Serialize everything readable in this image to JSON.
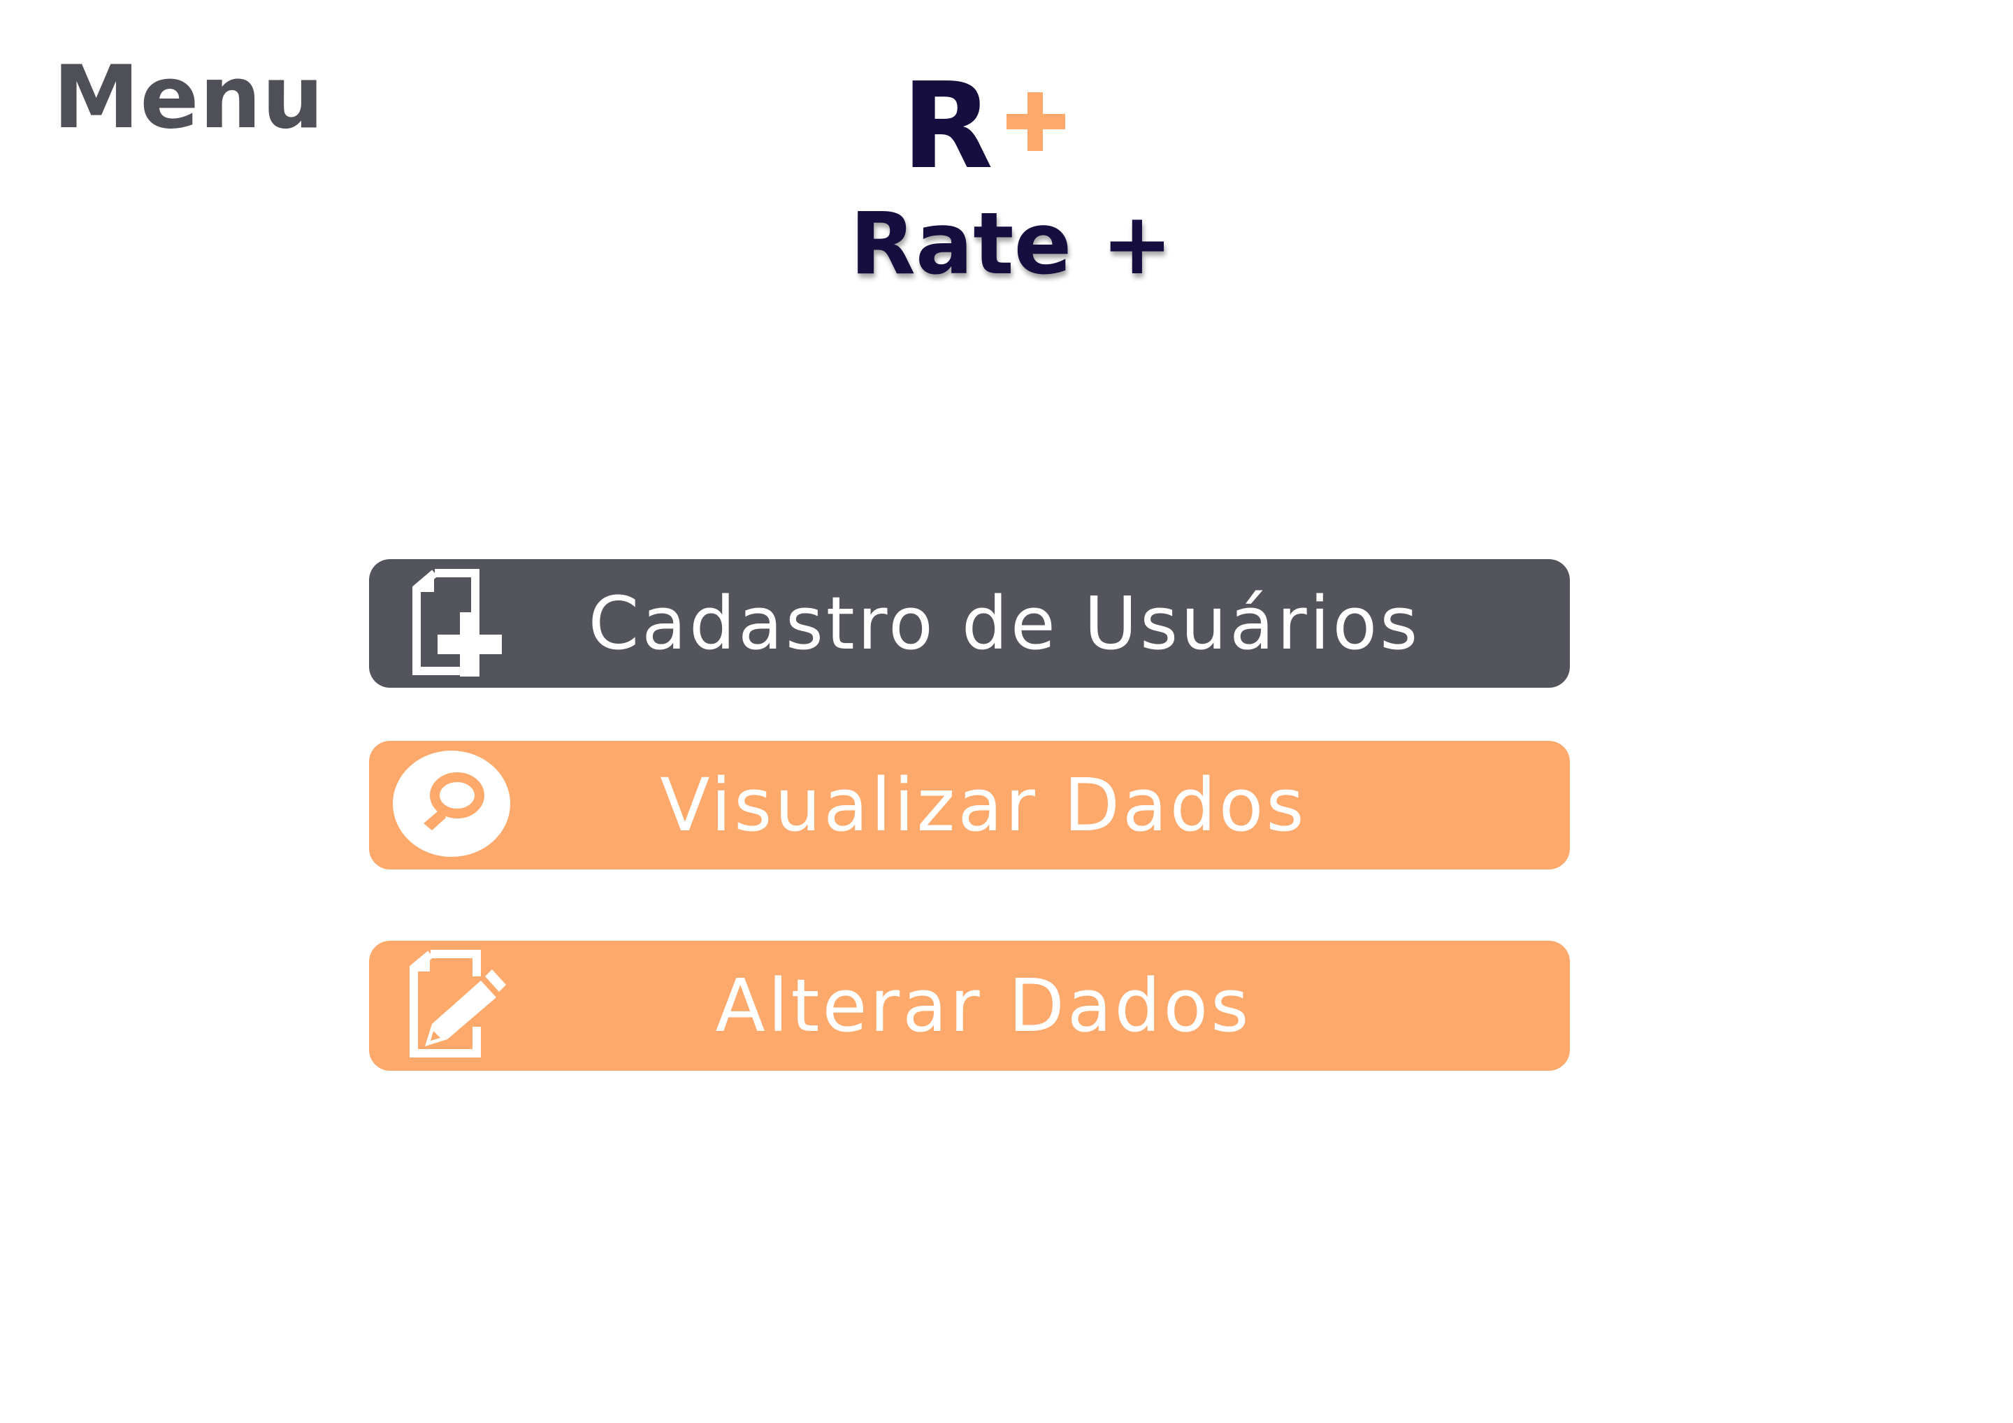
{
  "header": {
    "title": "Menu"
  },
  "logo": {
    "letter": "R",
    "app_name": "Rate +"
  },
  "menu": {
    "items": [
      {
        "label": "Cadastro de Usuários",
        "icon": "add-document-icon"
      },
      {
        "label": "Visualizar Dados",
        "icon": "search-icon"
      },
      {
        "label": "Alterar Dados",
        "icon": "edit-document-icon"
      }
    ]
  },
  "colors": {
    "title": "#4f5057",
    "brand_dark": "#150e3e",
    "brand_accent": "#fda96b",
    "button_dark": "#54555c",
    "button_orange": "#fda96b",
    "button_text": "#ffffff",
    "background": "#ffffff"
  }
}
